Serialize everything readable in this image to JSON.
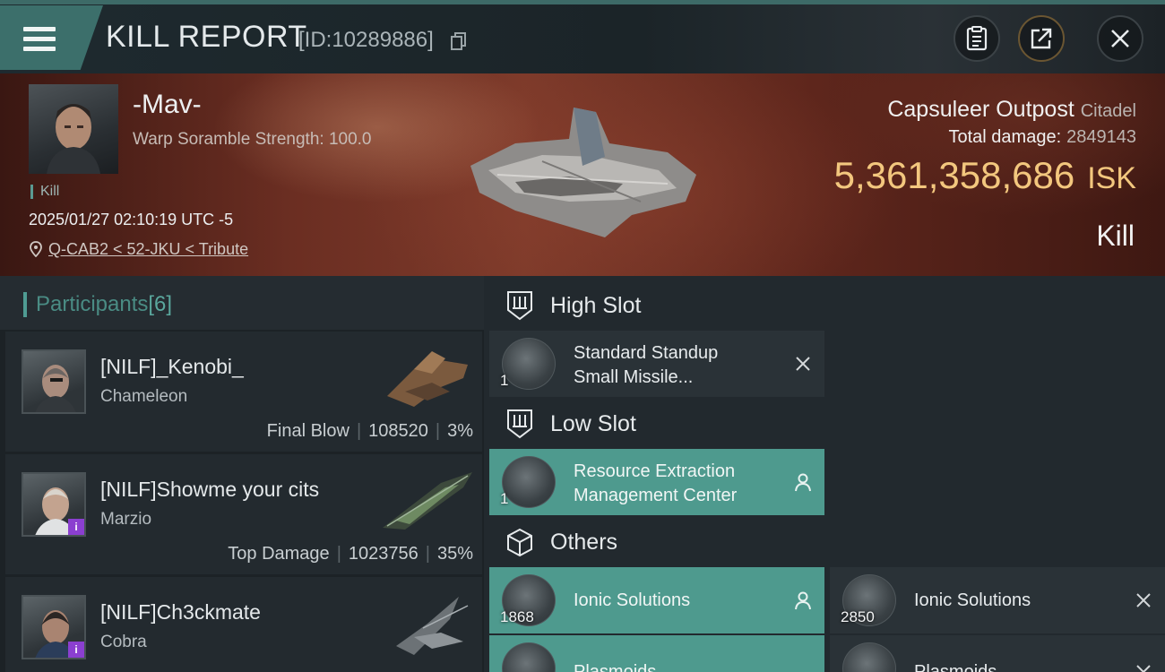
{
  "header": {
    "title": "KILL REPORT",
    "report_id": "[ID:10289886]"
  },
  "victim": {
    "name": "-Mav-",
    "scramble": "Warp Soramble Strength: 100.0",
    "tag": "Kill",
    "timestamp": "2025/01/27 02:10:19 UTC -5",
    "location": "Q-CAB2 < 52-JKU < Tribute",
    "structure": "Capsuleer Outpost",
    "structure_class": "Citadel",
    "total_damage_label": "Total damage:",
    "total_damage": "2849143",
    "isk_value": "5,361,358,686",
    "isk_unit": "ISK",
    "result": "Kill"
  },
  "participants": {
    "title": "Participants",
    "count": "[6]",
    "rows": [
      {
        "name": "[NILF]_Kenobi_",
        "ship": "Chameleon",
        "label": "Final Blow",
        "damage": "108520",
        "percent": "3%"
      },
      {
        "name": "[NILF]Showme your cits",
        "ship": "Marzio",
        "label": "Top Damage",
        "damage": "1023756",
        "percent": "35%"
      },
      {
        "name": "[NILF]Ch3ckmate",
        "ship": "Cobra",
        "label": "",
        "damage": "",
        "percent": ""
      }
    ]
  },
  "slots": {
    "high": {
      "title": "High Slot",
      "items": [
        {
          "name_line1": "Standard Standup",
          "name_line2": "Small Missile...",
          "qty": "1"
        }
      ]
    },
    "low": {
      "title": "Low Slot",
      "items": [
        {
          "name_line1": "Resource Extraction",
          "name_line2": "Management Center",
          "qty": "1"
        }
      ]
    },
    "others": {
      "title": "Others",
      "items": [
        {
          "name": "Ionic Solutions",
          "qty": "1868"
        },
        {
          "name": "Ionic Solutions",
          "qty": "2850"
        },
        {
          "name": "Plasmoids",
          "qty": ""
        },
        {
          "name": "Plasmoids",
          "qty": ""
        }
      ]
    }
  },
  "colors": {
    "accent_teal": "#4e9a8e",
    "isk_gold": "#f3c77e",
    "badge_purple": "#8b3fd0"
  }
}
